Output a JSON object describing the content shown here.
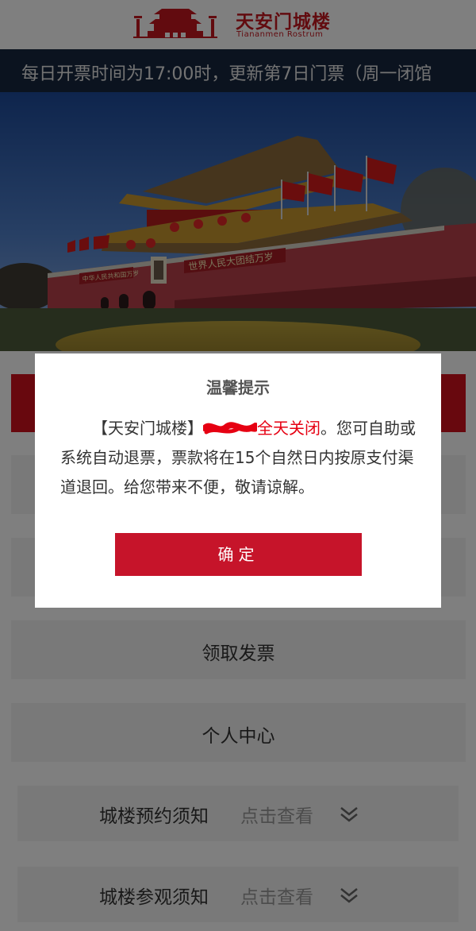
{
  "header": {
    "logo_icon": "gate-tower-icon",
    "title_cn": "天安门城楼",
    "title_en": "Tiananmen Rostrum"
  },
  "marquee": {
    "text": "每日开票时间为17:00时，更新第7日门票（周一闭馆"
  },
  "hero": {
    "image": "tiananmen-gate-photo",
    "banner_right": "世界人民大团结万岁",
    "banner_left": "中华人民共和国万岁"
  },
  "menu": {
    "invoice": "领取发票",
    "profile": "个人中心"
  },
  "notices": [
    {
      "label": "城楼预约须知",
      "link": "点击查看",
      "icon": "chevron-double-down-icon"
    },
    {
      "label": "城楼参观须知",
      "link": "点击查看",
      "icon": "chevron-double-down-icon"
    }
  ],
  "dialog": {
    "title": "温馨提示",
    "body_part1": "【天安门城楼】",
    "body_highlight": "全天关闭",
    "body_part2": "。您可自助或系统自动退票，票款将在15个自然日内按原支付渠道退回。给您带来不便，敬请谅解。",
    "confirm": "确定"
  },
  "colors": {
    "brand_red": "#c4161f",
    "marquee_bg": "#16273f",
    "highlight_red": "#e60012",
    "button_red": "#c6142a"
  }
}
